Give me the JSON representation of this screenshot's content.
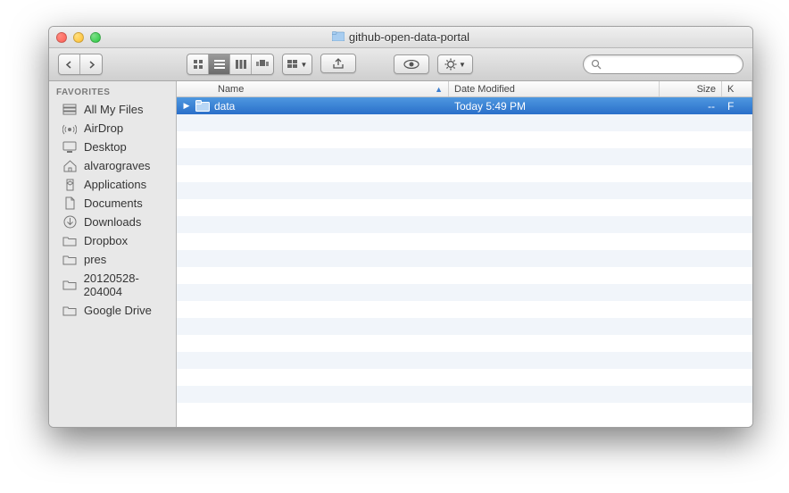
{
  "window": {
    "title": "github-open-data-portal"
  },
  "toolbar": {
    "searchPlaceholder": ""
  },
  "sidebar": {
    "sectionLabel": "FAVORITES",
    "items": [
      {
        "label": "All My Files"
      },
      {
        "label": "AirDrop"
      },
      {
        "label": "Desktop"
      },
      {
        "label": "alvarograves"
      },
      {
        "label": "Applications"
      },
      {
        "label": "Documents"
      },
      {
        "label": "Downloads"
      },
      {
        "label": "Dropbox"
      },
      {
        "label": "pres"
      },
      {
        "label": "20120528-204004"
      },
      {
        "label": "Google Drive"
      }
    ]
  },
  "columns": {
    "name": "Name",
    "date": "Date Modified",
    "size": "Size",
    "kind": "K"
  },
  "files": {
    "row0": {
      "name": "data",
      "date": "Today 5:49 PM",
      "size": "--",
      "kind": "F"
    }
  }
}
